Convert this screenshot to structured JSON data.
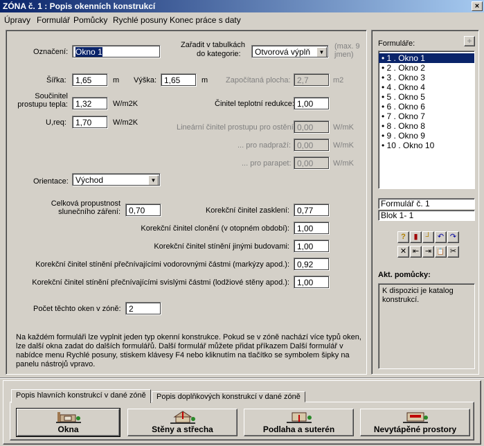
{
  "window": {
    "title": "ZÓNA č. 1 : Popis okenních konstrukcí",
    "close_label": "×"
  },
  "menu": [
    "Úpravy",
    "Formulář",
    "Pomůcky",
    "Rychlé posuny",
    "Konec práce s daty"
  ],
  "form": {
    "oznaceni_label": "Označení:",
    "oznaceni_value": "Okno 1",
    "zaradit_label_1": "Zařadit v tabulkách",
    "zaradit_label_2": "do kategorie:",
    "kategorie_value": "Otvorová výplň",
    "max_note_1": "(max. 9",
    "max_note_2": "jmen)",
    "sirka_label": "Šířka:",
    "sirka_value": "1,65",
    "sirka_unit": "m",
    "vyska_label": "Výška:",
    "vyska_value": "1,65",
    "vyska_unit": "m",
    "plocha_label": "Započítaná plocha:",
    "plocha_value": "2,7",
    "plocha_unit": "m2",
    "soucinitel_label_1": "Součinitel",
    "soucinitel_label_2": "prostupu tepla:",
    "soucinitel_value": "1,32",
    "soucinitel_unit": "W/m2K",
    "ureq_label": "U,req:",
    "ureq_value": "1,70",
    "ureq_unit": "W/m2K",
    "redukce_label": "Činitel teplotní redukce:",
    "redukce_value": "1,00",
    "linearni_label": "Lineární činitel prostupu pro ostění:",
    "linearni_value": "0,00",
    "linearni_unit": "W/mK",
    "nadprazi_label": "... pro nadpraží:",
    "nadprazi_value": "0,00",
    "nadprazi_unit": "W/mK",
    "parapet_label": "... pro parapet:",
    "parapet_value": "0,00",
    "parapet_unit": "W/mK",
    "orientace_label": "Orientace:",
    "orientace_value": "Východ",
    "propustnost_label_1": "Celková propustnost",
    "propustnost_label_2": "slunečního záření:",
    "propustnost_value": "0,70",
    "zaskleni_label": "Korekční činitel zasklení:",
    "zaskleni_value": "0,77",
    "cloneni_label": "Korekční činitel clonění (v otopném období):",
    "cloneni_value": "1,00",
    "budovy_label": "Korekční činitel stínění jinými budovami:",
    "budovy_value": "1,00",
    "vodorovne_label": "Korekční činitel stínění přečnívajícími vodorovnými částmi (markýzy apod.):",
    "vodorovne_value": "0,92",
    "svisle_label": "Korekční činitel stínění přečnívajícími svislými částmi (lodžiové stěny apod.):",
    "svisle_value": "1,00",
    "pocet_label": "Počet těchto oken v zóně:",
    "pocet_value": "2",
    "help_text_1": "Na každém formuláři lze vyplnit jeden typ okenní konstrukce. Pokud se v zóně nachází více typů oken,",
    "help_text_2": "lze další okna zadat do dalších formulářů. Další formulář můžete přidat příkazem Další formulář v",
    "help_text_3": "nabídce menu Rychlé posuny, stiskem klávesy F4 nebo kliknutím na tlačítko se symbolem šipky na",
    "help_text_4": "panelu nástrojů vpravo."
  },
  "sidebar": {
    "title": "Formuláře:",
    "add_label": "+",
    "forms": [
      "1 . Okno 1",
      "2 . Okno 2",
      "3 . Okno 3",
      "4 . Okno 4",
      "5 . Okno 5",
      "6 . Okno 6",
      "7 . Okno 7",
      "8 . Okno 8",
      "9 . Okno 9",
      "10 . Okno 10"
    ],
    "formular_info": "Formulář č.  1",
    "blok_info": "Blok  1-  1",
    "akt_title": "Akt. pomůcky:",
    "akt_text": "K dispozici je katalog konstrukcí."
  },
  "toolbar": {
    "row1": [
      "help-icon",
      "book-icon",
      "window-icon",
      "undo-icon",
      "redo-icon"
    ],
    "row2": [
      "delete-icon",
      "first-icon",
      "last-icon",
      "paste-icon",
      "cut-icon"
    ],
    "glyph1": [
      "?",
      "▮",
      "┘",
      "↶",
      "↷"
    ],
    "glyph2": [
      "✕",
      "⇤",
      "⇥",
      "📋",
      "✂"
    ]
  },
  "tabs": [
    "Popis hlavních konstrukcí v dané zóně",
    "Popis doplňkových konstrukcí v dané zóně"
  ],
  "bottom_buttons": [
    "Okna",
    "Stěny a střecha",
    "Podlaha a suterén",
    "Nevytápěné prostory"
  ],
  "colors": {
    "titlebar": "#0a246a",
    "face": "#d4d0c8",
    "selection": "#0a246a"
  }
}
